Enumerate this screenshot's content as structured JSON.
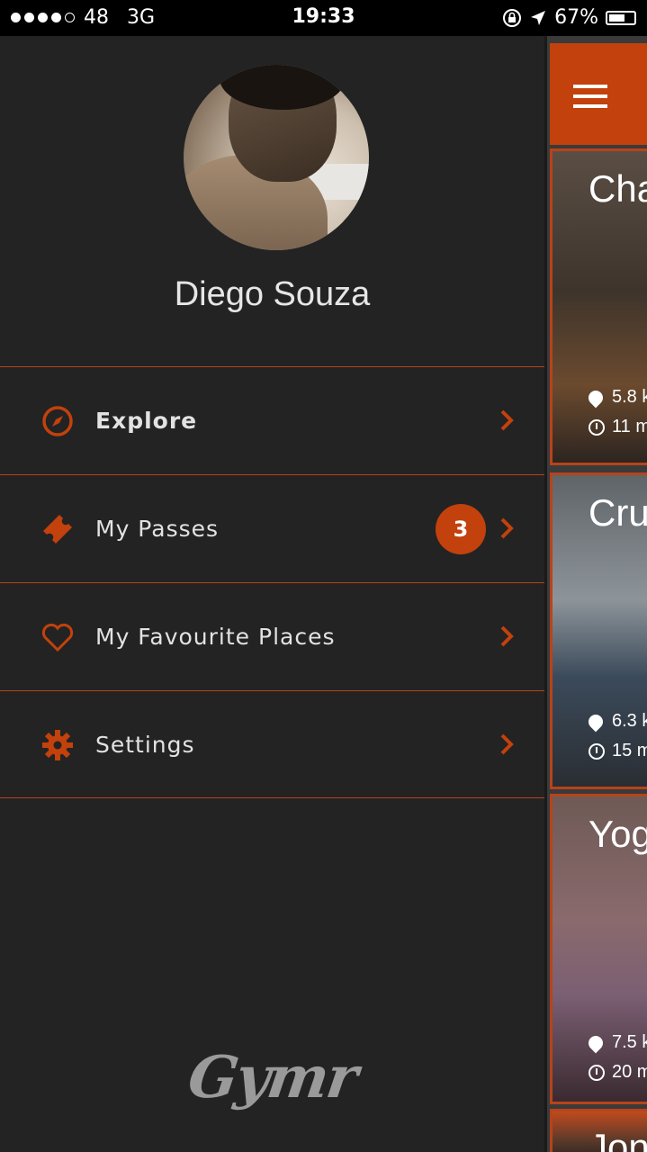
{
  "status_bar": {
    "carrier_signal": "48",
    "network": "3G",
    "time": "19:33",
    "battery": "67%",
    "icons": [
      "signal-dots-icon",
      "rotation-lock-icon",
      "location-arrow-icon",
      "battery-icon"
    ]
  },
  "drawer": {
    "user_name": "Diego Souza",
    "menu": [
      {
        "label": "Explore",
        "icon": "compass-icon"
      },
      {
        "label": "My Passes",
        "icon": "ticket-icon",
        "badge": "3"
      },
      {
        "label": "My Favourite Places",
        "icon": "heart-icon"
      },
      {
        "label": "Settings",
        "icon": "gear-icon"
      }
    ],
    "logo": "Gymr"
  },
  "content": {
    "cards": [
      {
        "title": "Cha",
        "distance": "5.8 k",
        "time": "11 m"
      },
      {
        "title": "Cru",
        "distance": "6.3 k",
        "time": "15 m"
      },
      {
        "title": "Yog",
        "distance": "7.5 k",
        "time": "20 m"
      },
      {
        "title": "Jon"
      }
    ]
  },
  "colors": {
    "accent": "#c2410c",
    "divider": "#b8431a",
    "background": "#232323"
  }
}
